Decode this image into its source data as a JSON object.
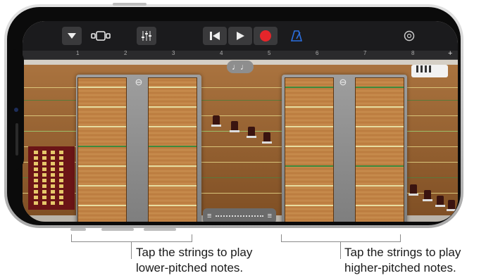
{
  "toolbar": {
    "icons": [
      "tracks-dropdown-icon",
      "view-toggle-icon",
      "mixer-icon",
      "rewind-icon",
      "play-icon",
      "record-icon",
      "metronome-icon",
      "settings-icon"
    ]
  },
  "ruler": {
    "numbers": [
      "1",
      "2",
      "3",
      "4",
      "5",
      "6",
      "7",
      "8"
    ],
    "plus": "+"
  },
  "controls": {
    "notes_label": "♩♩",
    "slider_left": "≡",
    "slider_right": "≡"
  },
  "callouts": {
    "left": {
      "line1": "Tap the strings to play",
      "line2": "lower-pitched notes."
    },
    "right": {
      "line1": "Tap the strings to play",
      "line2": "higher-pitched notes."
    }
  },
  "colors": {
    "record": "#e5252a",
    "metronome": "#2b6fe0",
    "wood": "#c98e4f"
  }
}
